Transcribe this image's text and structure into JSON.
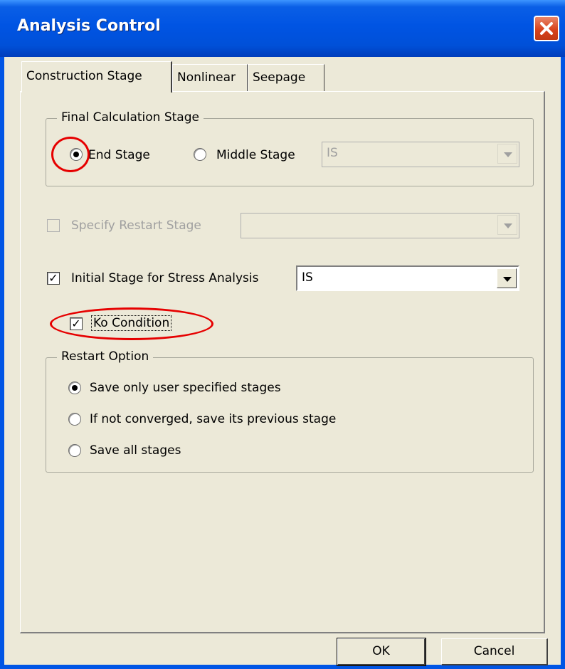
{
  "window": {
    "title": "Analysis Control"
  },
  "tabs": [
    {
      "label": "Construction Stage",
      "active": true
    },
    {
      "label": "Nonlinear",
      "active": false
    },
    {
      "label": "Seepage",
      "active": false
    }
  ],
  "final_calc": {
    "legend": "Final Calculation Stage",
    "end_stage_label": "End Stage",
    "end_stage_checked": true,
    "middle_stage_label": "Middle Stage",
    "middle_stage_checked": false,
    "middle_combo_value": "IS"
  },
  "restart_stage": {
    "label": "Specify Restart Stage",
    "checked": false,
    "combo_value": ""
  },
  "initial_stage": {
    "label": "Initial Stage for Stress Analysis",
    "checked": true,
    "combo_value": "IS"
  },
  "ko_condition": {
    "label": "Ko Condition",
    "checked": true
  },
  "restart_option": {
    "legend": "Restart Option",
    "options": [
      {
        "label": "Save only user specified stages",
        "checked": true
      },
      {
        "label": "If not converged, save its previous stage",
        "checked": false
      },
      {
        "label": "Save all stages",
        "checked": false
      }
    ]
  },
  "footer": {
    "ok_label": "OK",
    "cancel_label": "Cancel"
  },
  "colors": {
    "titlebar": "#0054e3",
    "dialog_bg": "#ece9d8",
    "annotation": "#e60000"
  }
}
